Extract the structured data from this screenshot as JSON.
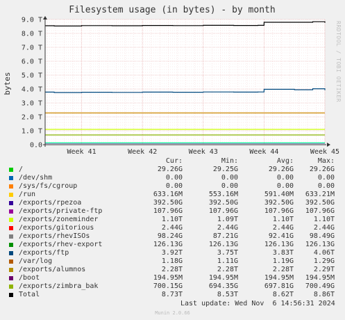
{
  "chart_data": {
    "type": "area",
    "title": "Filesystem usage (in bytes) - by month",
    "ylabel": "bytes",
    "side_text": "RRDTOOL / TOBI OETIKER",
    "ylim": [
      0,
      9.0
    ],
    "yunit": "T",
    "yticks": [
      "0.0",
      "1.0 T",
      "2.0 T",
      "3.0 T",
      "4.0 T",
      "5.0 T",
      "6.0 T",
      "7.0 T",
      "8.0 T",
      "9.0 T"
    ],
    "ytick_values": [
      0,
      1,
      2,
      3,
      4,
      5,
      6,
      7,
      8,
      9
    ],
    "x_range": [
      40.4,
      45.0
    ],
    "xticks": [
      "Week 41",
      "Week 42",
      "Week 43",
      "Week 44",
      "Week 45"
    ],
    "xtick_values": [
      41,
      42,
      43,
      44,
      45
    ],
    "grid": true,
    "series": [
      {
        "name": "Total",
        "color": "#000000",
        "x": [
          40.4,
          40.55,
          41.0,
          41.5,
          42.0,
          42.5,
          43.0,
          43.5,
          43.9,
          44.0,
          44.5,
          44.8,
          45.0
        ],
        "values": [
          8.55,
          8.53,
          8.56,
          8.55,
          8.57,
          8.56,
          8.58,
          8.57,
          8.58,
          8.8,
          8.8,
          8.84,
          8.76
        ]
      },
      {
        "name": "/exports/ftp",
        "color": "#00497f",
        "x": [
          40.4,
          40.55,
          41.0,
          41.5,
          42.0,
          42.5,
          43.0,
          43.5,
          43.9,
          44.0,
          44.5,
          44.8,
          45.0
        ],
        "values": [
          3.78,
          3.75,
          3.77,
          3.76,
          3.78,
          3.77,
          3.79,
          3.78,
          3.79,
          3.98,
          3.95,
          4.02,
          3.92
        ]
      },
      {
        "name": "/exports/zoneminder",
        "color": "#ccff00",
        "x": [
          40.4,
          45.0
        ],
        "values": [
          1.1,
          1.1
        ]
      },
      {
        "name": "/exports/alumnos",
        "color": "#cc8800",
        "x": [
          40.4,
          45.0
        ],
        "values": [
          2.28,
          2.28
        ]
      },
      {
        "name": "/exports/rhev-export",
        "color": "#00ff99",
        "x": [
          40.4,
          45.0
        ],
        "values": [
          0.13,
          0.13
        ]
      },
      {
        "name": "/exports/private-ftp",
        "color": "#9900cc",
        "x": [
          40.4,
          45.0
        ],
        "values": [
          0.108,
          0.108
        ]
      },
      {
        "name": "/exports/rhevISOs",
        "color": "#888888",
        "x": [
          40.4,
          45.0
        ],
        "values": [
          0.098,
          0.098
        ]
      },
      {
        "name": "/exports/zimbra_bak",
        "color": "#88b200",
        "x": [
          40.4,
          45.0
        ],
        "values": [
          0.7,
          0.7
        ]
      }
    ]
  },
  "legend": {
    "headers": [
      "Cur:",
      "Min:",
      "Avg:",
      "Max:"
    ],
    "rows": [
      {
        "name": "/",
        "color": "#00cc00",
        "cur": "29.26G",
        "min": "29.25G",
        "avg": "29.26G",
        "max": "29.26G"
      },
      {
        "name": "/dev/shm",
        "color": "#0066b3",
        "cur": "0.00",
        "min": "0.00",
        "avg": "0.00",
        "max": "0.00"
      },
      {
        "name": "/sys/fs/cgroup",
        "color": "#ff8000",
        "cur": "0.00",
        "min": "0.00",
        "avg": "0.00",
        "max": "0.00"
      },
      {
        "name": "/run",
        "color": "#ffcc00",
        "cur": "633.16M",
        "min": "553.16M",
        "avg": "591.40M",
        "max": "633.21M"
      },
      {
        "name": "/exports/rpezoa",
        "color": "#330099",
        "cur": "392.50G",
        "min": "392.50G",
        "avg": "392.50G",
        "max": "392.50G"
      },
      {
        "name": "/exports/private-ftp",
        "color": "#990099",
        "cur": "107.96G",
        "min": "107.96G",
        "avg": "107.96G",
        "max": "107.96G"
      },
      {
        "name": "/exports/zoneminder",
        "color": "#ccff00",
        "cur": "1.10T",
        "min": "1.09T",
        "avg": "1.10T",
        "max": "1.10T"
      },
      {
        "name": "/exports/gitorious",
        "color": "#ff0000",
        "cur": "2.44G",
        "min": "2.44G",
        "avg": "2.44G",
        "max": "2.44G"
      },
      {
        "name": "/exports/rhevISOs",
        "color": "#808080",
        "cur": "98.24G",
        "min": "87.21G",
        "avg": "92.41G",
        "max": "98.49G"
      },
      {
        "name": "/exports/rhev-export",
        "color": "#008f00",
        "cur": "126.13G",
        "min": "126.13G",
        "avg": "126.13G",
        "max": "126.13G"
      },
      {
        "name": "/exports/ftp",
        "color": "#00487d",
        "cur": "3.92T",
        "min": "3.75T",
        "avg": "3.83T",
        "max": "4.06T"
      },
      {
        "name": "/var/log",
        "color": "#b35a00",
        "cur": "1.18G",
        "min": "1.11G",
        "avg": "1.19G",
        "max": "1.29G"
      },
      {
        "name": "/exports/alumnos",
        "color": "#b38f00",
        "cur": "2.28T",
        "min": "2.28T",
        "avg": "2.28T",
        "max": "2.29T"
      },
      {
        "name": "/boot",
        "color": "#6b006b",
        "cur": "194.95M",
        "min": "194.95M",
        "avg": "194.95M",
        "max": "194.95M"
      },
      {
        "name": "/exports/zimbra_bak",
        "color": "#8fb300",
        "cur": "700.15G",
        "min": "694.35G",
        "avg": "697.81G",
        "max": "700.49G"
      },
      {
        "name": "Total",
        "color": "#000000",
        "cur": "8.73T",
        "min": "8.53T",
        "avg": "8.62T",
        "max": "8.86T"
      }
    ]
  },
  "footer": {
    "last_update": "Last update: Wed Nov  6 14:56:31 2024",
    "generator": "Munin 2.0.66"
  }
}
